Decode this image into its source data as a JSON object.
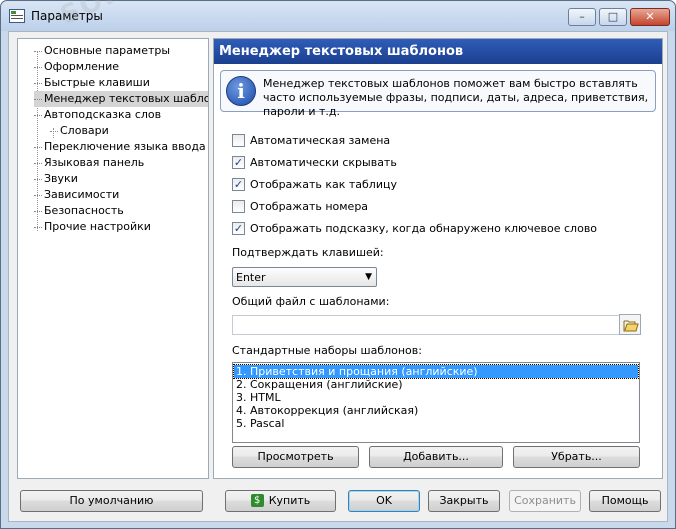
{
  "window": {
    "title": "Параметры",
    "controls": {
      "minimize": "–",
      "maximize": "□",
      "close": "✕"
    }
  },
  "sidebar": {
    "items": [
      {
        "label": "Основные параметры",
        "level": 0,
        "selected": false
      },
      {
        "label": "Оформление",
        "level": 0,
        "selected": false
      },
      {
        "label": "Быстрые клавиши",
        "level": 0,
        "selected": false
      },
      {
        "label": "Менеджер текстовых шаблонов",
        "level": 0,
        "selected": true
      },
      {
        "label": "Автоподсказка слов",
        "level": 0,
        "selected": false
      },
      {
        "label": "Словари",
        "level": 1,
        "selected": false
      },
      {
        "label": "Переключение языка ввода",
        "level": 0,
        "selected": false
      },
      {
        "label": "Языковая панель",
        "level": 0,
        "selected": false
      },
      {
        "label": "Звуки",
        "level": 0,
        "selected": false
      },
      {
        "label": "Зависимости",
        "level": 0,
        "selected": false
      },
      {
        "label": "Безопасность",
        "level": 0,
        "selected": false
      },
      {
        "label": "Прочие настройки",
        "level": 0,
        "selected": false
      }
    ]
  },
  "panel": {
    "title": "Менеджер текстовых шаблонов",
    "info": "Менеджер текстовых шаблонов поможет вам быстро вставлять часто используемые фразы, подписи, даты, адреса, приветствия, пароли и т.д.",
    "checkboxes": [
      {
        "label": "Автоматическая замена",
        "checked": false
      },
      {
        "label": "Автоматически скрывать",
        "checked": true
      },
      {
        "label": "Отображать как таблицу",
        "checked": true
      },
      {
        "label": "Отображать номера",
        "checked": false
      },
      {
        "label": "Отображать подсказку, когда обнаружено ключевое слово",
        "checked": true
      }
    ],
    "confirm_key_label": "Подтверждать клавишей:",
    "confirm_key_value": "Enter",
    "shared_file_label": "Общий файл с шаблонами:",
    "shared_file_value": "",
    "sets_label": "Стандартные наборы шаблонов:",
    "sets": [
      {
        "label": "1. Приветствия и прощания (английские)",
        "selected": true
      },
      {
        "label": "2. Сокращения (английские)",
        "selected": false
      },
      {
        "label": "3. HTML",
        "selected": false
      },
      {
        "label": "4. Автокоррекция (английская)",
        "selected": false
      },
      {
        "label": "5. Pascal",
        "selected": false
      }
    ],
    "buttons": {
      "view": "Просмотреть",
      "add": "Добавить...",
      "remove": "Убрать..."
    }
  },
  "footer": {
    "defaults": "По умолчанию",
    "buy": "Купить",
    "ok": "OK",
    "close": "Закрыть",
    "save": "Сохранить",
    "help": "Помощь"
  },
  "colors": {
    "header_bg": "#2f5db8",
    "selection": "#3399ff",
    "window_frame": "#c9d9ec"
  }
}
